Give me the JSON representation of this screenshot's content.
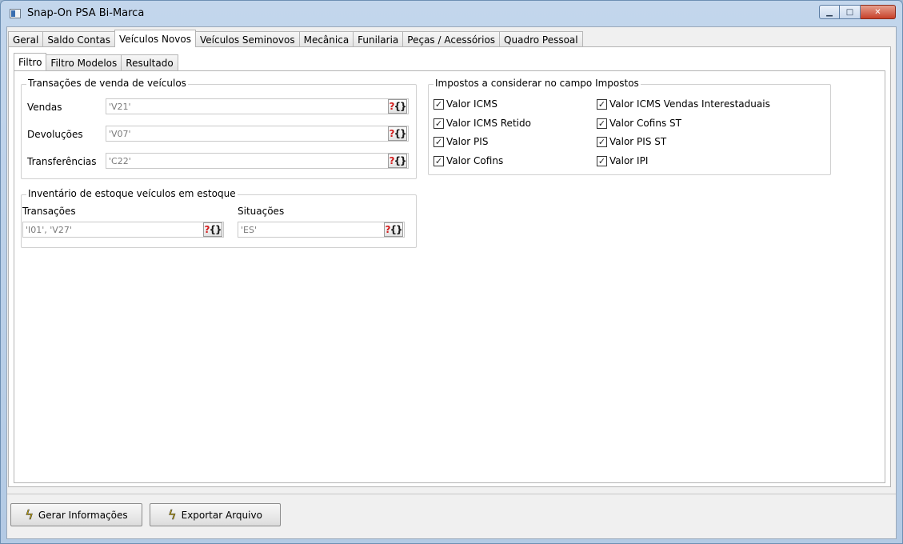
{
  "window": {
    "title": "Snap-On PSA Bi-Marca",
    "min_glyph": "▁",
    "max_glyph": "□",
    "close_glyph": "✕"
  },
  "main_tabs": [
    {
      "label": "Geral",
      "active": false
    },
    {
      "label": "Saldo Contas",
      "active": false
    },
    {
      "label": "Veículos Novos",
      "active": true
    },
    {
      "label": "Veículos Seminovos",
      "active": false
    },
    {
      "label": "Mecânica",
      "active": false
    },
    {
      "label": "Funilaria",
      "active": false
    },
    {
      "label": "Peças / Acessórios",
      "active": false
    },
    {
      "label": "Quadro Pessoal",
      "active": false
    }
  ],
  "sub_tabs": [
    {
      "label": "Filtro",
      "active": true
    },
    {
      "label": "Filtro Modelos",
      "active": false
    },
    {
      "label": "Resultado",
      "active": false
    }
  ],
  "lookup_button": {
    "q": "?",
    "brace": "{}"
  },
  "vendas_group": {
    "title": "Transações de venda de veículos",
    "vendas_label": "Vendas",
    "vendas_value": "'V21'",
    "devolucoes_label": "Devoluções",
    "devolucoes_value": "'V07'",
    "transferencias_label": "Transferências",
    "transferencias_value": "'C22'"
  },
  "inventario_group": {
    "title": "Inventário de estoque veículos em estoque",
    "transacoes_label": "Transações",
    "transacoes_value": "'I01', 'V27'",
    "situacoes_label": "Situações",
    "situacoes_value": "'ES'"
  },
  "impostos_group": {
    "title": "Impostos a considerar no campo Impostos",
    "check_glyph": "✓",
    "left": [
      {
        "label": "Valor ICMS",
        "checked": true
      },
      {
        "label": "Valor ICMS Retido",
        "checked": true
      },
      {
        "label": "Valor PIS",
        "checked": true
      },
      {
        "label": "Valor Cofins",
        "checked": true
      }
    ],
    "right": [
      {
        "label": "Valor ICMS Vendas Interestaduais",
        "checked": true
      },
      {
        "label": "Valor Cofins ST",
        "checked": true
      },
      {
        "label": "Valor PIS ST",
        "checked": true
      },
      {
        "label": "Valor IPI",
        "checked": true
      }
    ]
  },
  "actions": {
    "bolt_glyph": "ϟ",
    "gerar_label": "Gerar Informações",
    "exportar_label": "Exportar Arquivo"
  }
}
